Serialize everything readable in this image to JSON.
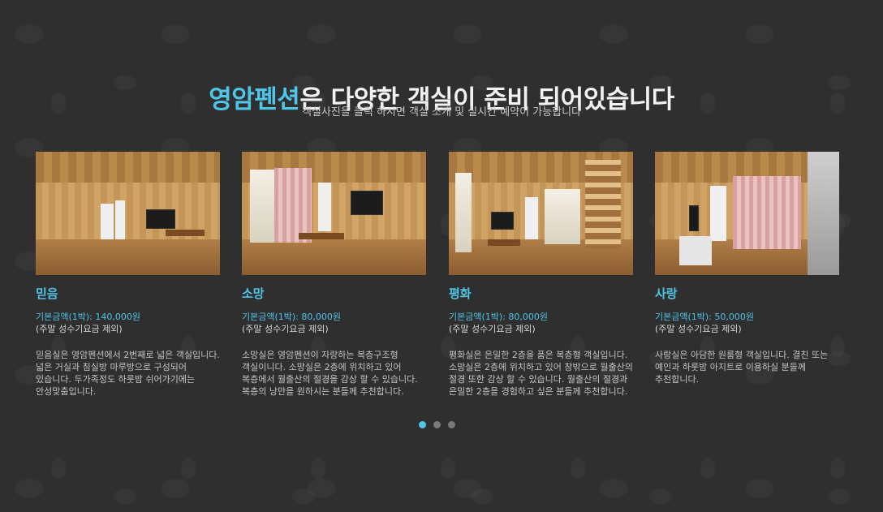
{
  "header": {
    "title_accent": "영암펜션",
    "title_rest": "은 다양한 객실이 준비 되어있습니다",
    "subtitle": "객실사진을 클릭 하시면 객실 소개 및 실시간 예약이 가능합니다"
  },
  "rooms": [
    {
      "name": "믿음",
      "price": "기본금액(1박): 140,000원",
      "note": "(주말 성수기요금 제외)",
      "description": "믿음실은 영암펜션에서 2번째로 넓은 객실입니다. 넓은 거실과 침실방 마루방으로 구성되어 있습니다. 두가족정도 하룻밤 쉬어가기에는 안성맞춤입니다."
    },
    {
      "name": "소망",
      "price": "기본금액(1박): 80,000원",
      "note": "(주말 성수기요금 제외)",
      "description": "소망실은 영암펜션이 자랑하는 복층구조형 객실이니다. 소망실은 2층에 위치하고 있어 복층에서 월출산의 절경을 감상 할 수 있습니다. 복층의 낭만을 원하시는 분들께 추천합니다."
    },
    {
      "name": "평화",
      "price": "기본금액(1박): 80,000원",
      "note": "(주말 성수기요금 제외)",
      "description": "평화실은 은밀한 2층을 품은 복층형 객실입니다. 소망실은 2층에 위치하고 있어 창밖으로 월출산의 절경 또한 감상 할 수 있습니다. 월출산의 절경과 은밀한 2층을 경험하고 싶은 분들께 추천합니다."
    },
    {
      "name": "사랑",
      "price": "기본금액(1박): 50,000원",
      "note": "(주말 성수기요금 제외)",
      "description": "사랑실은 아담한 원룸형 객실입니다. 결친 또는 예인과 하룻밤 아지트로 이용하실 분들께 추천합니다."
    }
  ],
  "carousel": {
    "pages": 3,
    "active": 1
  },
  "colors": {
    "accent": "#4fc6e8",
    "background": "#2f2f2f"
  }
}
